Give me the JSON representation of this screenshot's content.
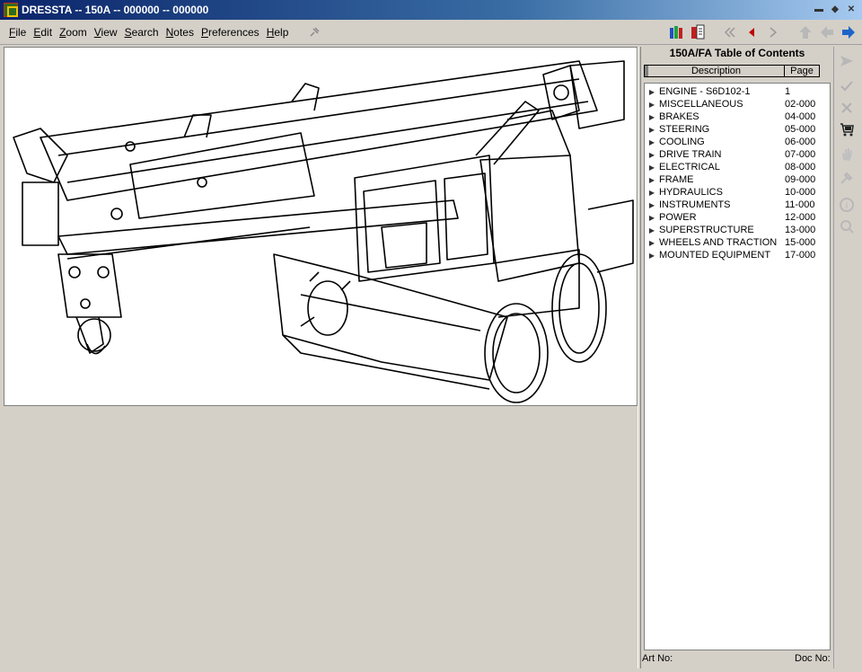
{
  "window": {
    "title": "DRESSTA -- 150A -- 000000 -- 000000",
    "controls": [
      "minimize",
      "restore",
      "close"
    ]
  },
  "menu": {
    "items": [
      {
        "label": "File",
        "accel": "F"
      },
      {
        "label": "Edit",
        "accel": "E"
      },
      {
        "label": "Zoom",
        "accel": "Z"
      },
      {
        "label": "View",
        "accel": "V"
      },
      {
        "label": "Search",
        "accel": "S"
      },
      {
        "label": "Notes",
        "accel": "N"
      },
      {
        "label": "Preferences",
        "accel": "P"
      },
      {
        "label": "Help",
        "accel": "H"
      }
    ]
  },
  "toolbar": {
    "icons": [
      "books-icon",
      "book-page-icon",
      "first-page-icon",
      "previous-page-icon",
      "next-page-icon",
      "up-level-icon",
      "back-icon",
      "forward-icon"
    ],
    "accent": "#0a246a",
    "nav_red": "#c00000",
    "nav_blue": "#1e64c8"
  },
  "toc": {
    "title": "150A/FA Table of Contents",
    "col_description": "Description",
    "col_page": "Page",
    "rows": [
      {
        "description": "ENGINE - S6D102-1",
        "page": "1"
      },
      {
        "description": "MISCELLANEOUS",
        "page": "02-000"
      },
      {
        "description": "BRAKES",
        "page": "04-000"
      },
      {
        "description": "STEERING",
        "page": "05-000"
      },
      {
        "description": "COOLING",
        "page": "06-000"
      },
      {
        "description": "DRIVE TRAIN",
        "page": "07-000"
      },
      {
        "description": "ELECTRICAL",
        "page": "08-000"
      },
      {
        "description": "FRAME",
        "page": "09-000"
      },
      {
        "description": "HYDRAULICS",
        "page": "10-000"
      },
      {
        "description": "INSTRUMENTS",
        "page": "11-000"
      },
      {
        "description": "POWER",
        "page": "12-000"
      },
      {
        "description": "SUPERSTRUCTURE",
        "page": "13-000"
      },
      {
        "description": "WHEELS AND TRACTION",
        "page": "15-000"
      },
      {
        "description": "MOUNTED EQUIPMENT",
        "page": "17-000"
      }
    ]
  },
  "status": {
    "art_no_label": "Art No:",
    "doc_no_label": "Doc No:"
  },
  "side_tools": [
    "send-icon",
    "check-icon",
    "delete-icon",
    "cart-icon",
    "hand-icon",
    "tool-icon",
    "info-icon",
    "zoom-search-icon"
  ]
}
